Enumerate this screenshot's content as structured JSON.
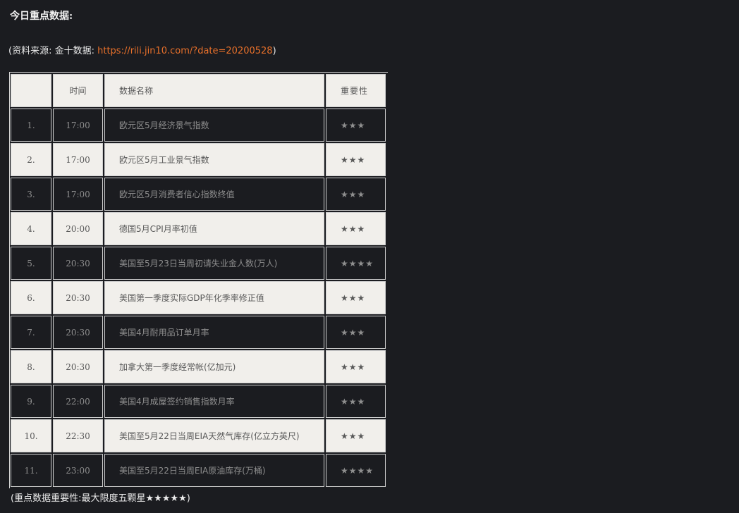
{
  "heading": "今日重点数据:",
  "source": {
    "prefix": "(资料来源: 金十数据: ",
    "link": "https://rili.jin10.com/?date=20200528",
    "suffix": ")"
  },
  "table": {
    "headers": {
      "index": "",
      "time": "时间",
      "name": "数据名称",
      "importance": "重要性"
    },
    "rows": [
      {
        "index": "1.",
        "time": "17:00",
        "name": "欧元区5月经济景气指数",
        "stars": "★★★"
      },
      {
        "index": "2.",
        "time": "17:00",
        "name": "欧元区5月工业景气指数",
        "stars": "★★★"
      },
      {
        "index": "3.",
        "time": "17:00",
        "name": "欧元区5月消费者信心指数终值",
        "stars": "★★★"
      },
      {
        "index": "4.",
        "time": "20:00",
        "name": "德国5月CPI月率初值",
        "stars": "★★★"
      },
      {
        "index": "5.",
        "time": "20:30",
        "name": "美国至5月23日当周初请失业金人数(万人)",
        "stars": "★★★★"
      },
      {
        "index": "6.",
        "time": "20:30",
        "name": "美国第一季度实际GDP年化季率修正值",
        "stars": "★★★"
      },
      {
        "index": "7.",
        "time": "20:30",
        "name": "美国4月耐用品订单月率",
        "stars": "★★★"
      },
      {
        "index": "8.",
        "time": "20:30",
        "name": "加拿大第一季度经常帐(亿加元)",
        "stars": "★★★"
      },
      {
        "index": "9.",
        "time": "22:00",
        "name": "美国4月成屋签约销售指数月率",
        "stars": "★★★"
      },
      {
        "index": "10.",
        "time": "22:30",
        "name": "美国至5月22日当周EIA天然气库存(亿立方英尺)",
        "stars": "★★★"
      },
      {
        "index": "11.",
        "time": "23:00",
        "name": "美国至5月22日当周EIA原油库存(万桶)",
        "stars": "★★★★"
      }
    ]
  },
  "note": "(重点数据重要性:最大限度五颗星★★★★★)"
}
